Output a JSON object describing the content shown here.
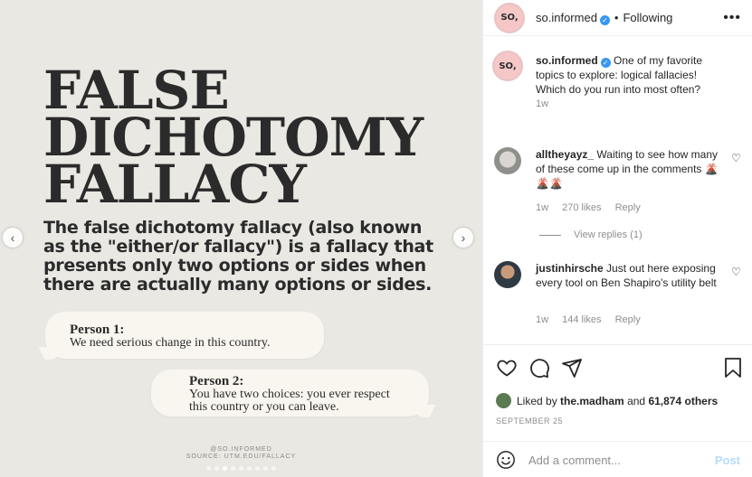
{
  "post_image": {
    "headline": [
      "FALSE",
      "DICHOTOMY",
      "FALLACY"
    ],
    "body": "The false dichotomy fallacy (also known as the \"either/or fallacy\") is a fallacy that presents only two options or sides when there are actually many options or sides.",
    "person1": {
      "speaker": "Person 1:",
      "line": "We need serious change in this country."
    },
    "person2": {
      "speaker": "Person 2:",
      "line1": "You have two choices: you ever respect",
      "line2": "this country or you can leave."
    },
    "credit_handle": "@SO.INFORMED",
    "credit_source": "SOURCE: UTM.EDU/FALLACY",
    "carousel_dots": 9,
    "active_dot": 3
  },
  "header": {
    "avatar_text": "SO,",
    "username": "so.informed",
    "separator": "•",
    "following": "Following"
  },
  "caption": {
    "avatar_text": "SO,",
    "username": "so.informed",
    "text": "One of my favorite topics to explore: logical fallacies! Which do you run into most often?",
    "time": "1w"
  },
  "comments": [
    {
      "username": "alltheyayz_",
      "text": "Waiting to see how many of these come up in the comments 🌋🌋🌋",
      "time": "1w",
      "likes": "270 likes",
      "reply": "Reply",
      "view_replies": "View replies (1)"
    },
    {
      "username": "justinhirsche",
      "text": "Just out here exposing every tool on Ben Shapiro's utility belt",
      "time": "1w",
      "likes": "144 likes",
      "reply": "Reply"
    }
  ],
  "likes": {
    "prefix": "Liked by",
    "liker": "the.madham",
    "and": "and",
    "others": "61,874 others"
  },
  "date": "SEPTEMBER 25",
  "add_comment": {
    "placeholder": "Add a comment...",
    "post_label": "Post"
  },
  "colors": {
    "link_blue": "#3897f0",
    "post_disabled": "#b3dbff",
    "bg": "#e9e8e3"
  }
}
